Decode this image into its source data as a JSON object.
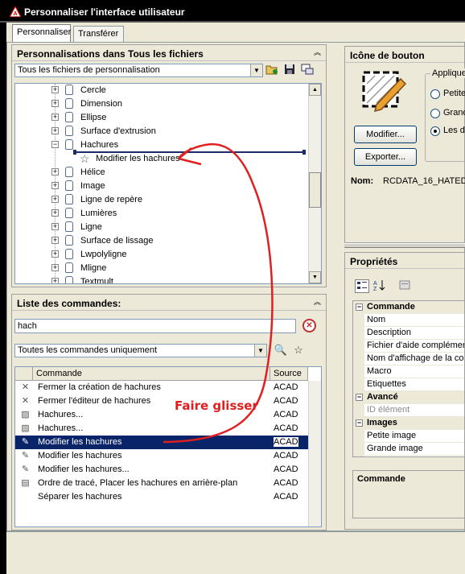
{
  "window": {
    "title": "Personnaliser l'interface utilisateur"
  },
  "tabs": [
    {
      "label": "Personnaliser"
    },
    {
      "label": "Transférer"
    }
  ],
  "customizations": {
    "header": "Personnalisations dans Tous les fichiers",
    "file_select": "Tous les fichiers de personnalisation",
    "tree": [
      {
        "label": "Cercle",
        "expanded": false
      },
      {
        "label": "Dimension",
        "expanded": false
      },
      {
        "label": "Ellipse",
        "expanded": false
      },
      {
        "label": "Surface d'extrusion",
        "expanded": false
      },
      {
        "label": "Hachures",
        "expanded": true
      },
      {
        "label": "Modifier les hachures",
        "child": true
      },
      {
        "label": "Hélice",
        "expanded": false
      },
      {
        "label": "Image",
        "expanded": false
      },
      {
        "label": "Ligne de repère",
        "expanded": false
      },
      {
        "label": "Lumières",
        "expanded": false
      },
      {
        "label": "Ligne",
        "expanded": false
      },
      {
        "label": "Surface de lissage",
        "expanded": false
      },
      {
        "label": "Lwpolyligne",
        "expanded": false
      },
      {
        "label": "Mligne",
        "expanded": false
      },
      {
        "label": "Textmult",
        "expanded": false
      }
    ]
  },
  "command_list": {
    "header": "Liste des commandes:",
    "search_value": "hach",
    "filter": "Toutes les commandes uniquement",
    "columns": {
      "command": "Commande",
      "source": "Source"
    },
    "rows": [
      {
        "name": "Fermer la création de hachures",
        "source": "ACAD",
        "icon": "close-hatch-icon",
        "selected": false
      },
      {
        "name": "Fermer l'éditeur de hachures",
        "source": "ACAD",
        "icon": "close-hatch-icon",
        "selected": false
      },
      {
        "name": "Hachures...",
        "source": "ACAD",
        "icon": "hatch-icon",
        "selected": false
      },
      {
        "name": "Hachures...",
        "source": "ACAD",
        "icon": "hatch-icon",
        "selected": false
      },
      {
        "name": "Modifier les hachures",
        "source": "ACAD",
        "icon": "edit-hatch-icon",
        "selected": true
      },
      {
        "name": "Modifier les hachures",
        "source": "ACAD",
        "icon": "edit-hatch-icon",
        "selected": false
      },
      {
        "name": "Modifier les hachures...",
        "source": "ACAD",
        "icon": "edit-hatch-icon",
        "selected": false
      },
      {
        "name": "Ordre de tracé, Placer les hachures en arrière-plan",
        "source": "ACAD",
        "icon": "draw-order-icon",
        "selected": false
      },
      {
        "name": "Séparer les hachures",
        "source": "ACAD",
        "icon": "",
        "selected": false
      }
    ]
  },
  "button_image": {
    "header": "Icône de bouton",
    "modify_label": "Modifier...",
    "export_label": "Exporter...",
    "apply_group": "Applique",
    "radio_small": "Petite",
    "radio_large": "Grand",
    "radio_both": "Les d",
    "name_label": "Nom:",
    "name_value": "RCDATA_16_HATED"
  },
  "properties": {
    "header": "Propriétés",
    "rows": [
      {
        "label": "Commande",
        "category": true
      },
      {
        "label": "Nom",
        "category": false
      },
      {
        "label": "Description",
        "category": false
      },
      {
        "label": "Fichier d'aide complément",
        "category": false
      },
      {
        "label": "Nom d'affichage de la com",
        "category": false
      },
      {
        "label": "Macro",
        "category": false
      },
      {
        "label": "Etiquettes",
        "category": false
      },
      {
        "label": "Avancé",
        "category": true
      },
      {
        "label": "ID élément",
        "category": false,
        "disabled": true
      },
      {
        "label": "Images",
        "category": true
      },
      {
        "label": "Petite image",
        "category": false
      },
      {
        "label": "Grande image",
        "category": false
      }
    ],
    "description_title": "Commande"
  },
  "annotation": {
    "text": "Faire glisser",
    "color": "#e02020"
  }
}
